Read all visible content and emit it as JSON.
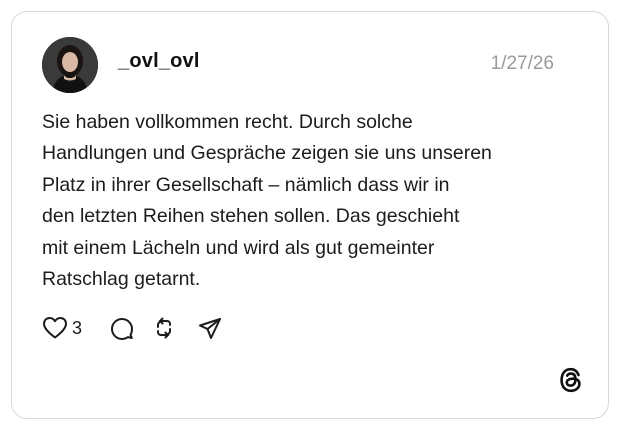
{
  "post": {
    "username": "_ovl_ovl",
    "date": "1/27/26",
    "text_lines": [
      "Sie haben vollkommen recht. Durch solche",
      "Handlungen und Gespräche zeigen sie uns unseren",
      "Platz in ihrer Gesellschaft – nämlich dass wir in",
      "den letzten Reihen stehen sollen. Das geschieht",
      "mit einem Lächeln und wird als gut gemeinter",
      "Ratschlag getarnt."
    ],
    "like_count": "3"
  },
  "icons": {
    "like": "heart-icon",
    "reply": "comment-icon",
    "repost": "repost-icon",
    "share": "send-icon",
    "brand": "threads-logo-icon"
  },
  "colors": {
    "text": "#1c1c1c",
    "muted": "#9a9a9a",
    "border": "#d9d9d9"
  }
}
